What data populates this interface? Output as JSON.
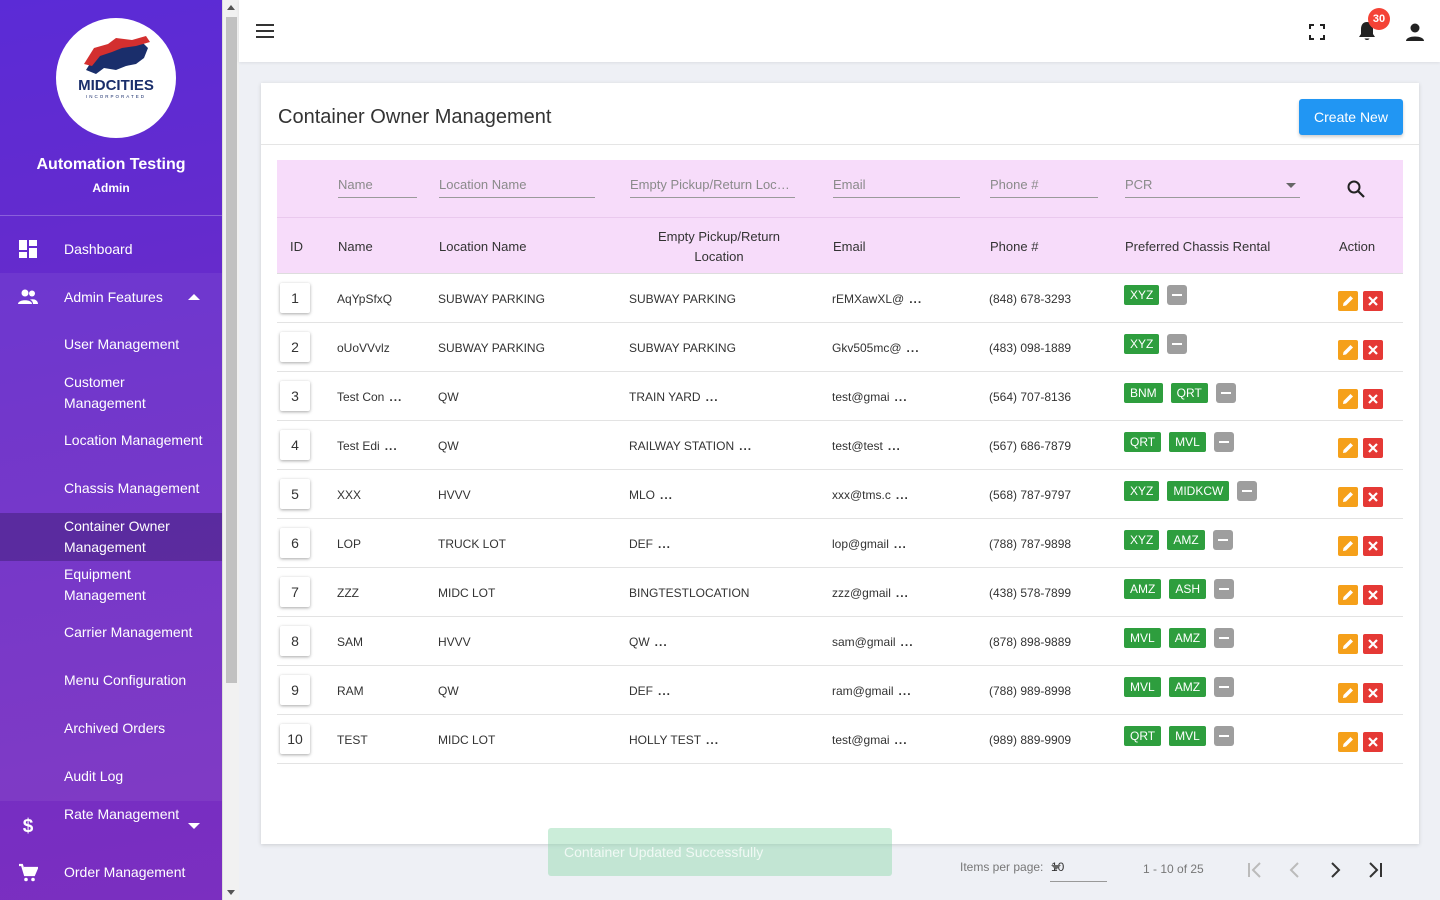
{
  "org": {
    "logo_text": "MIDCITIES",
    "logo_sub": "INCORPORATED",
    "name": "Automation Testing",
    "role": "Admin"
  },
  "sidebar": {
    "items": [
      {
        "label": "Dashboard",
        "icon": "dashboard-icon"
      },
      {
        "label": "Admin Features",
        "icon": "people-icon"
      },
      {
        "label": "User Management"
      },
      {
        "label": "Customer Management"
      },
      {
        "label": "Location Management"
      },
      {
        "label": "Chassis Management"
      },
      {
        "label": "Container Owner Management"
      },
      {
        "label": "Equipment Management"
      },
      {
        "label": "Carrier Management"
      },
      {
        "label": "Menu Configuration"
      },
      {
        "label": "Archived Orders"
      },
      {
        "label": "Audit Log"
      },
      {
        "label": "Rate Management",
        "icon": "dollar-icon"
      },
      {
        "label": "Order Management",
        "icon": "cart-icon"
      }
    ]
  },
  "topbar": {
    "notification_count": "30"
  },
  "page": {
    "title": "Container Owner Management",
    "create_label": "Create New"
  },
  "filters": {
    "name": "Name",
    "location": "Location Name",
    "empty_pickup": "Empty Pickup/Return Location",
    "email": "Email",
    "phone": "Phone #",
    "pcr": "PCR"
  },
  "columns": {
    "id": "ID",
    "name": "Name",
    "location": "Location Name",
    "empty_pickup": "Empty Pickup/Return Location",
    "email": "Email",
    "phone": "Phone #",
    "chassis": "Preferred Chassis Rental",
    "action": "Action"
  },
  "rows": [
    {
      "id": "1",
      "name": "AqYpSfxQ",
      "name_trunc": false,
      "location": "SUBWAY PARKING",
      "pickup": "SUBWAY PARKING",
      "pickup_trunc": false,
      "email": "rEMXawXL@",
      "phone": "(848) 678-3293",
      "chips": [
        "XYZ"
      ]
    },
    {
      "id": "2",
      "name": "oUoVVvlz",
      "name_trunc": false,
      "location": "SUBWAY PARKING",
      "pickup": "SUBWAY PARKING",
      "pickup_trunc": false,
      "email": "Gkv505mc@",
      "phone": "(483) 098-1889",
      "chips": [
        "XYZ"
      ]
    },
    {
      "id": "3",
      "name": "Test Con",
      "name_trunc": true,
      "location": "QW",
      "pickup": "TRAIN YARD",
      "pickup_trunc": true,
      "email": "test@gmai",
      "phone": "(564) 707-8136",
      "chips": [
        "BNM",
        "QRT"
      ]
    },
    {
      "id": "4",
      "name": "Test Edi",
      "name_trunc": true,
      "location": "QW",
      "pickup": "RAILWAY STATION",
      "pickup_trunc": true,
      "email": "test@test",
      "phone": "(567) 686-7879",
      "chips": [
        "QRT",
        "MVL"
      ]
    },
    {
      "id": "5",
      "name": "XXX",
      "name_trunc": false,
      "location": "HVVV",
      "pickup": "MLO",
      "pickup_trunc": true,
      "email": "xxx@tms.c",
      "phone": "(568) 787-9797",
      "chips": [
        "XYZ",
        "MIDKCW"
      ]
    },
    {
      "id": "6",
      "name": "LOP",
      "name_trunc": false,
      "location": "TRUCK LOT",
      "pickup": "DEF",
      "pickup_trunc": true,
      "email": "lop@gmail",
      "phone": "(788) 787-9898",
      "chips": [
        "XYZ",
        "AMZ"
      ]
    },
    {
      "id": "7",
      "name": "ZZZ",
      "name_trunc": false,
      "location": "MIDC LOT",
      "pickup": "BINGTESTLOCATION",
      "pickup_trunc": false,
      "email": "zzz@gmail",
      "phone": "(438) 578-7899",
      "chips": [
        "AMZ",
        "ASH"
      ]
    },
    {
      "id": "8",
      "name": "SAM",
      "name_trunc": false,
      "location": "HVVV",
      "pickup": "QW",
      "pickup_trunc": true,
      "email": "sam@gmail",
      "phone": "(878) 898-9889",
      "chips": [
        "MVL",
        "AMZ"
      ]
    },
    {
      "id": "9",
      "name": "RAM",
      "name_trunc": false,
      "location": "QW",
      "pickup": "DEF",
      "pickup_trunc": true,
      "email": "ram@gmail",
      "phone": "(788) 989-8998",
      "chips": [
        "MVL",
        "AMZ"
      ]
    },
    {
      "id": "10",
      "name": "TEST",
      "name_trunc": false,
      "location": "MIDC LOT",
      "pickup": "HOLLY TEST",
      "pickup_trunc": true,
      "email": "test@gmai",
      "phone": "(989) 889-9909",
      "chips": [
        "QRT",
        "MVL"
      ]
    }
  ],
  "ellipsis": "...",
  "paginator": {
    "items_per_page_label": "Items per page:",
    "items_per_page": "10",
    "range": "1 - 10 of 25"
  },
  "toast": "Container Updated Successfully",
  "colors": {
    "sidebar": "#5b2bd6",
    "primary": "#2196f3",
    "header_bg": "#f7dcfa",
    "chip": "#2e9e3e",
    "edit": "#f5a01a",
    "delete": "#e53935"
  }
}
